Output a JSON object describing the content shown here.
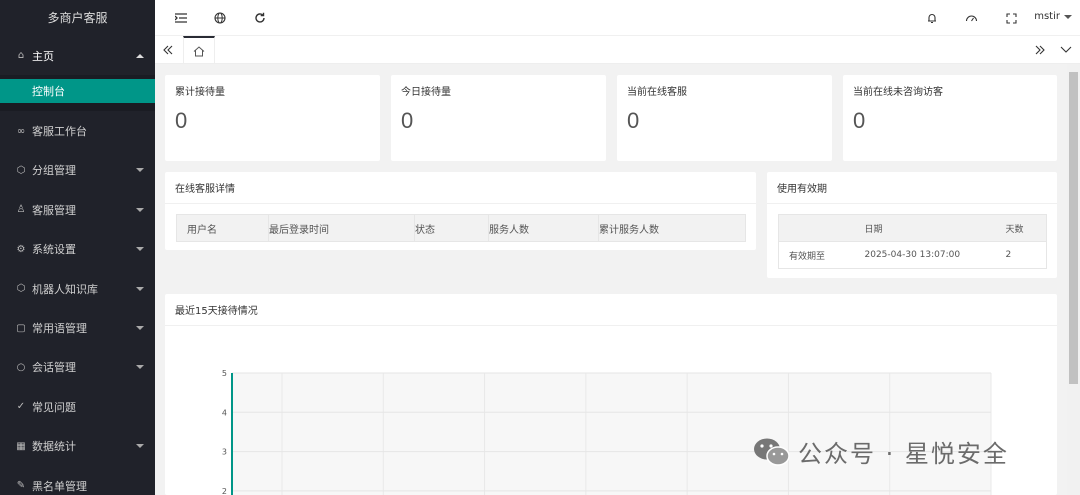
{
  "sidebar": {
    "logo": "多商户客服",
    "items": [
      {
        "label": "主页",
        "icon": "home-icon",
        "glyph": "⌂"
      },
      {
        "label": "客服工作台",
        "icon": "infinity-icon",
        "glyph": "∞"
      },
      {
        "label": "分组管理",
        "icon": "cube-icon",
        "glyph": "⬡"
      },
      {
        "label": "客服管理",
        "icon": "user-icon",
        "glyph": "♙"
      },
      {
        "label": "系统设置",
        "icon": "gear-icon",
        "glyph": "⚙"
      },
      {
        "label": "机器人知识库",
        "icon": "cube-icon",
        "glyph": "⬡"
      },
      {
        "label": "常用语管理",
        "icon": "note-icon",
        "glyph": "▢"
      },
      {
        "label": "会话管理",
        "icon": "chat-icon",
        "glyph": "○"
      },
      {
        "label": "常见问题",
        "icon": "shield-check-icon",
        "glyph": "✓"
      },
      {
        "label": "数据统计",
        "icon": "chart-icon",
        "glyph": "▦"
      },
      {
        "label": "黑名单管理",
        "icon": "edit-icon",
        "glyph": "✎"
      }
    ],
    "submenu_active": "控制台"
  },
  "header": {
    "username": "mstir"
  },
  "stats": [
    {
      "title": "累计接待量",
      "value": "0"
    },
    {
      "title": "今日接待量",
      "value": "0"
    },
    {
      "title": "当前在线客服",
      "value": "0"
    },
    {
      "title": "当前在线未咨询访客",
      "value": "0"
    }
  ],
  "online_panel": {
    "title": "在线客服详情",
    "columns": [
      "用户名",
      "最后登录时间",
      "状态",
      "服务人数",
      "累计服务人数"
    ]
  },
  "validity_panel": {
    "title": "使用有效期",
    "columns": [
      "",
      "日期",
      "天数"
    ],
    "row": [
      "有效期至",
      "2025-04-30 13:07:00",
      "2"
    ]
  },
  "chart_panel": {
    "title": "最近15天接待情况"
  },
  "chart_data": {
    "type": "line",
    "title": "",
    "y_ticks": [
      "5",
      "4",
      "3",
      "2"
    ],
    "ylim": [
      0,
      5
    ],
    "series": [],
    "grid": true,
    "accent": "#009688"
  },
  "watermark": "公众号 · 星悦安全",
  "colors": {
    "sidebar_bg": "#20222a",
    "active": "#009688"
  }
}
